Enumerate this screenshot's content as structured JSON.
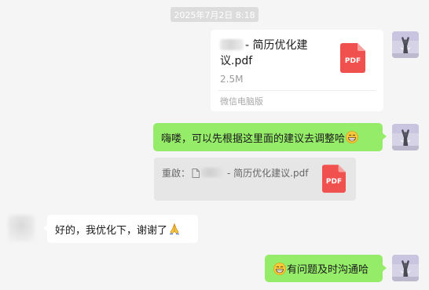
{
  "timestamp": "2025年7月2日 8:18",
  "file_message": {
    "name_suffix": "- 简历优化建议.pdf",
    "size": "2.5M",
    "source": "微信电脑版",
    "icon_label": "PDF"
  },
  "messages": [
    {
      "sender": "me",
      "text": "嗨喽，可以先根据这里面的建议去调整哈",
      "emoji": "grinning-face"
    },
    {
      "sender": "other",
      "text": "好的，我优化下，谢谢了",
      "emoji": "folded-hands"
    },
    {
      "sender": "me",
      "text": "有问题及时沟通哈",
      "emoji": "grinning-face"
    }
  ],
  "quote": {
    "prefix": "重啟：",
    "file_name": "- 简历优化建议.pdf",
    "icon_label": "PDF"
  },
  "colors": {
    "background": "#f5f5f5",
    "sent_bubble": "#95ec69",
    "received_bubble": "#ffffff",
    "pdf_red": "#f0514f",
    "quote_bg": "#e6e6e6"
  }
}
